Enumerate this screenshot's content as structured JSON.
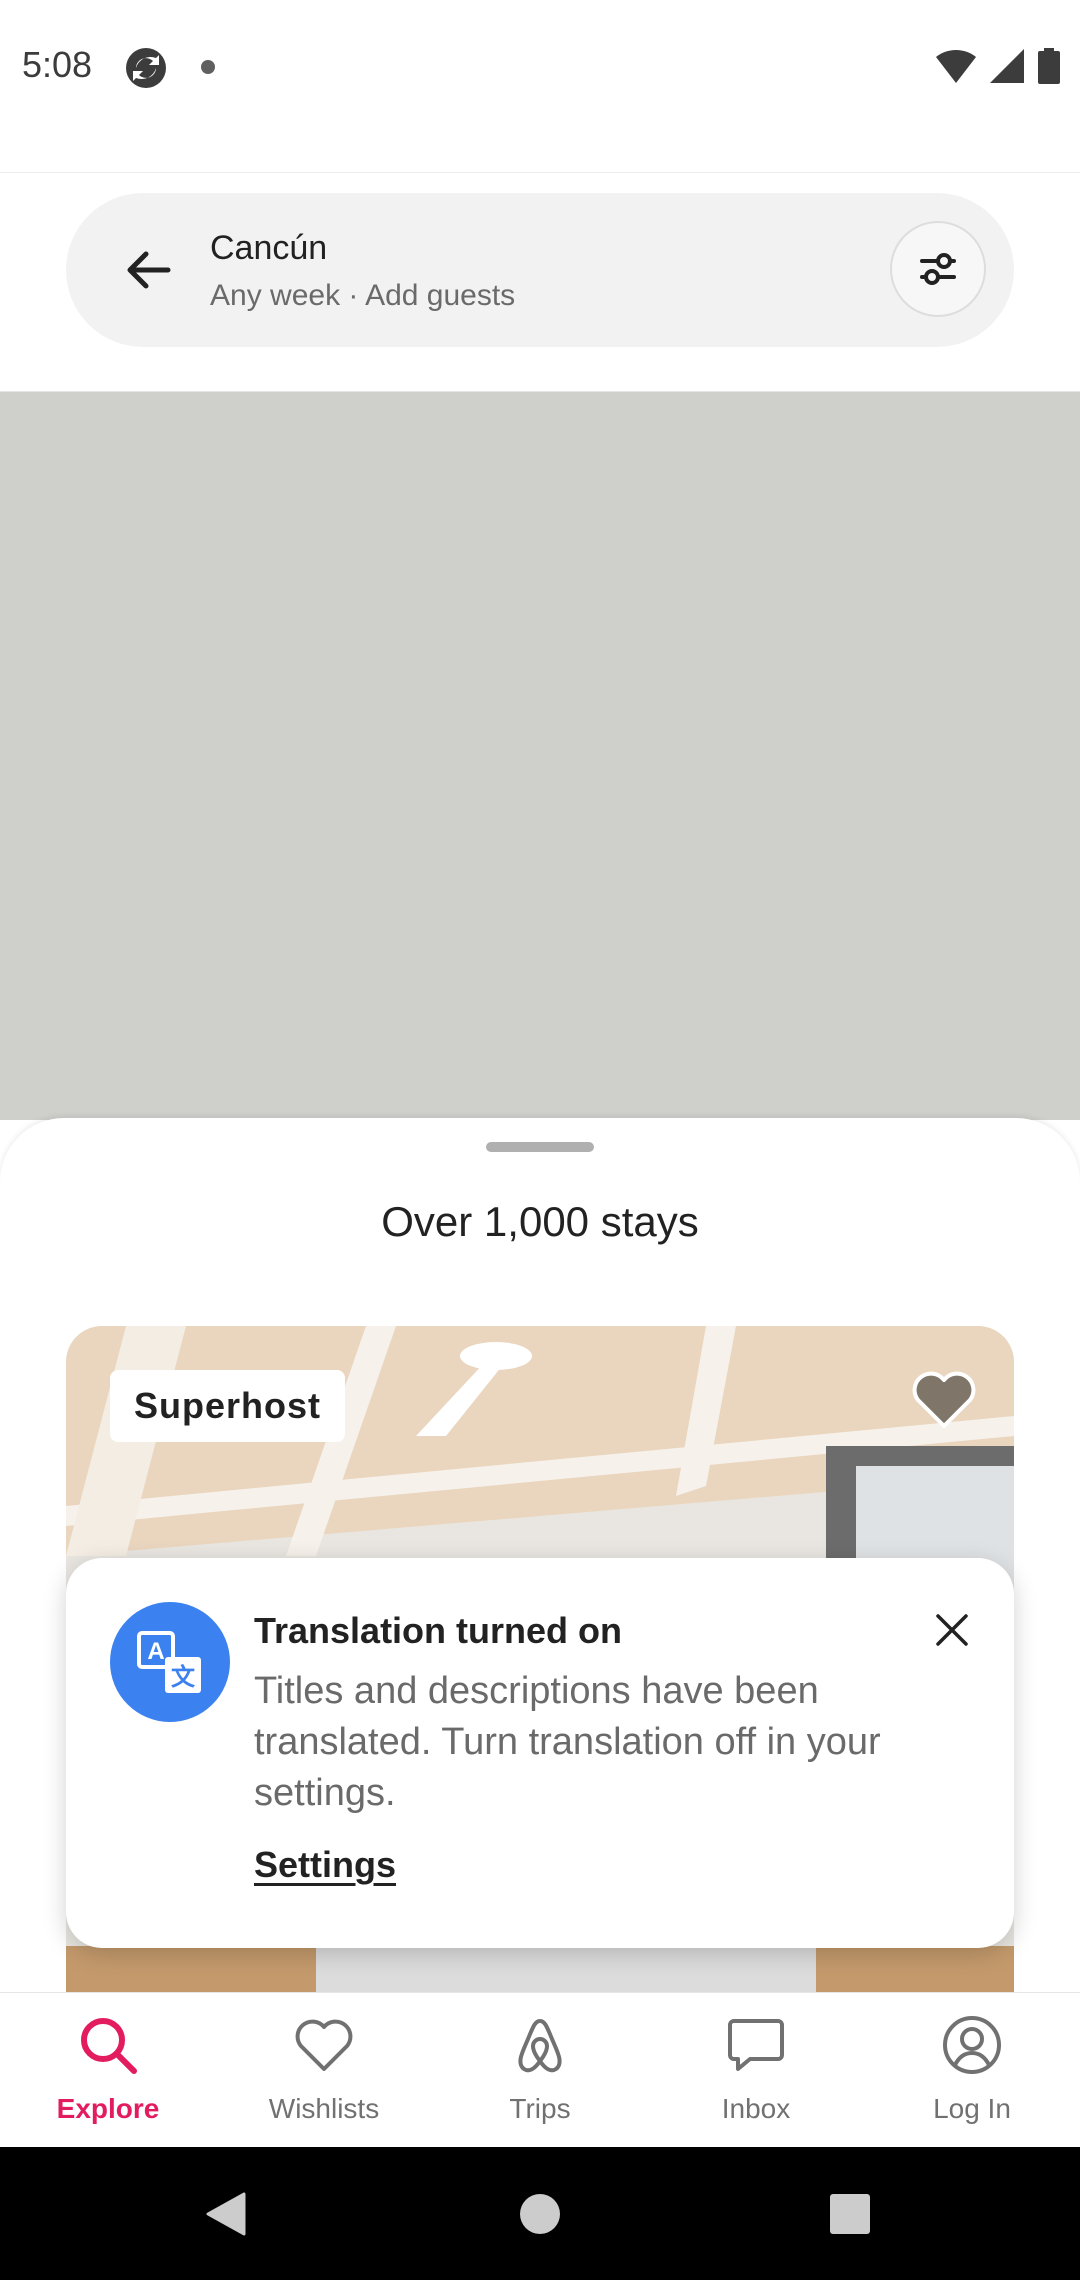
{
  "status_bar": {
    "time": "5:08",
    "icons": [
      "sync-app-icon",
      "notification-dot",
      "wifi-icon",
      "signal-icon",
      "battery-icon"
    ]
  },
  "header": {
    "location": "Cancún",
    "details": "Any week · Add guests",
    "back_icon": "arrow-left-icon",
    "filter_icon": "filter-sliders-icon"
  },
  "sheet": {
    "title": "Over 1,000 stays"
  },
  "listing": {
    "badge": "Superhost",
    "wishlist_icon": "heart-icon"
  },
  "toast": {
    "icon": "translate-icon",
    "title": "Translation turned on",
    "body": "Titles and descriptions have been translated. Turn translation off in your settings.",
    "link": "Settings",
    "accent_color": "#3b82f0"
  },
  "bottom_nav": {
    "items": [
      {
        "label": "Explore",
        "icon": "search-icon",
        "active": true
      },
      {
        "label": "Wishlists",
        "icon": "heart-icon",
        "active": false
      },
      {
        "label": "Trips",
        "icon": "airbnb-logo-icon",
        "active": false
      },
      {
        "label": "Inbox",
        "icon": "message-icon",
        "active": false
      },
      {
        "label": "Log In",
        "icon": "profile-icon",
        "active": false
      }
    ],
    "active_color": "#e31c5f"
  },
  "system_nav": {
    "icons": [
      "back-triangle-icon",
      "home-circle-icon",
      "recents-square-icon"
    ]
  }
}
